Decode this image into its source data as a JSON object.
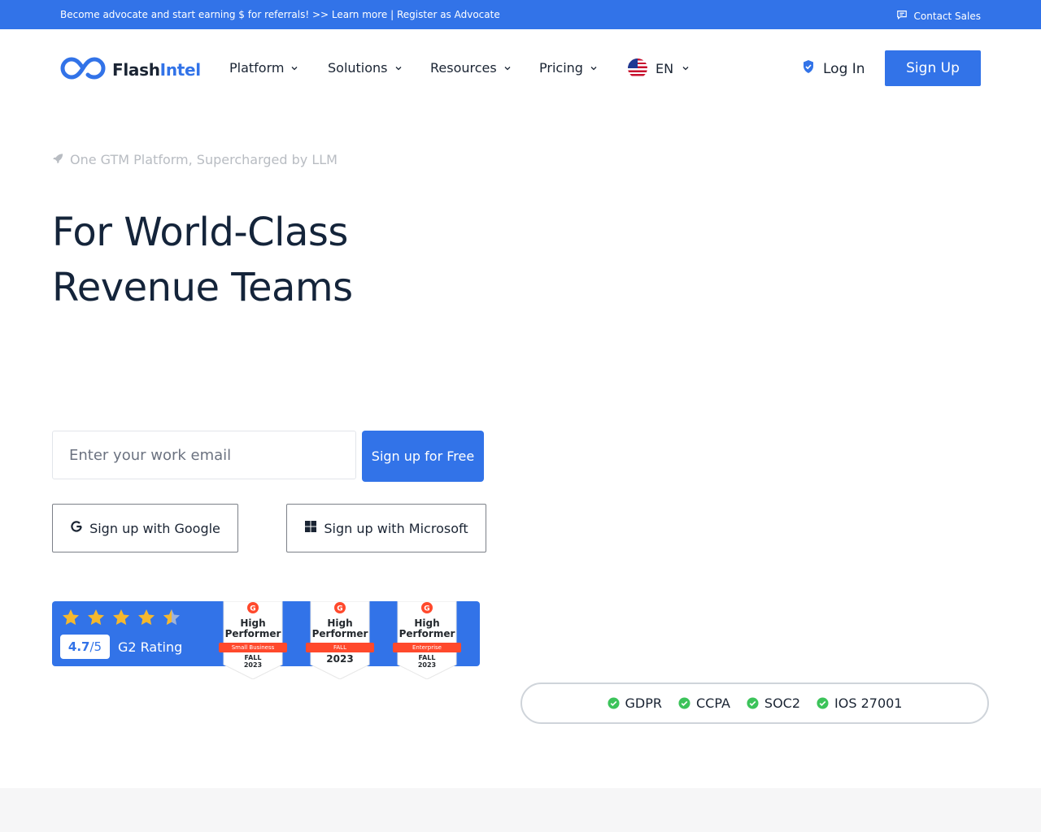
{
  "topbar": {
    "promo": "Become advocate and start earning $ for referrals! >> Learn more | Register as Advocate",
    "contact": "Contact Sales"
  },
  "brand": {
    "part1": "Flash",
    "part2": "Intel"
  },
  "nav": {
    "items": [
      {
        "label": "Platform"
      },
      {
        "label": "Solutions"
      },
      {
        "label": "Resources"
      },
      {
        "label": "Pricing"
      }
    ],
    "language": "EN",
    "login": "Log In",
    "signup": "Sign Up"
  },
  "hero": {
    "tagline": "One GTM Platform, Supercharged by LLM",
    "line1": "For World-Class",
    "line2": "Revenue Teams"
  },
  "form": {
    "email_placeholder": "Enter your work email",
    "email_value": "",
    "submit": "Sign up for Free",
    "google": "Sign up with Google",
    "microsoft": "Sign up with Microsoft"
  },
  "g2": {
    "rating": "4.7",
    "out_of": "/5",
    "stars": 4.5,
    "label": "G2 Rating",
    "badges": [
      {
        "title1": "High",
        "title2": "Performer",
        "ribbon": "Small Business",
        "season1": "FALL",
        "season2": "2023"
      },
      {
        "title1": "High",
        "title2": "Performer",
        "ribbon": "FALL",
        "season1": "2023",
        "season2": ""
      },
      {
        "title1": "High",
        "title2": "Performer",
        "ribbon": "Enterprise",
        "season1": "FALL",
        "season2": "2023"
      }
    ]
  },
  "compliance": [
    "GDPR",
    "CCPA",
    "SOC2",
    "IOS 27001"
  ],
  "colors": {
    "accent": "#3273e8",
    "check": "#3cc35a",
    "g2_red": "#ff492c",
    "star": "#f5b82e"
  }
}
